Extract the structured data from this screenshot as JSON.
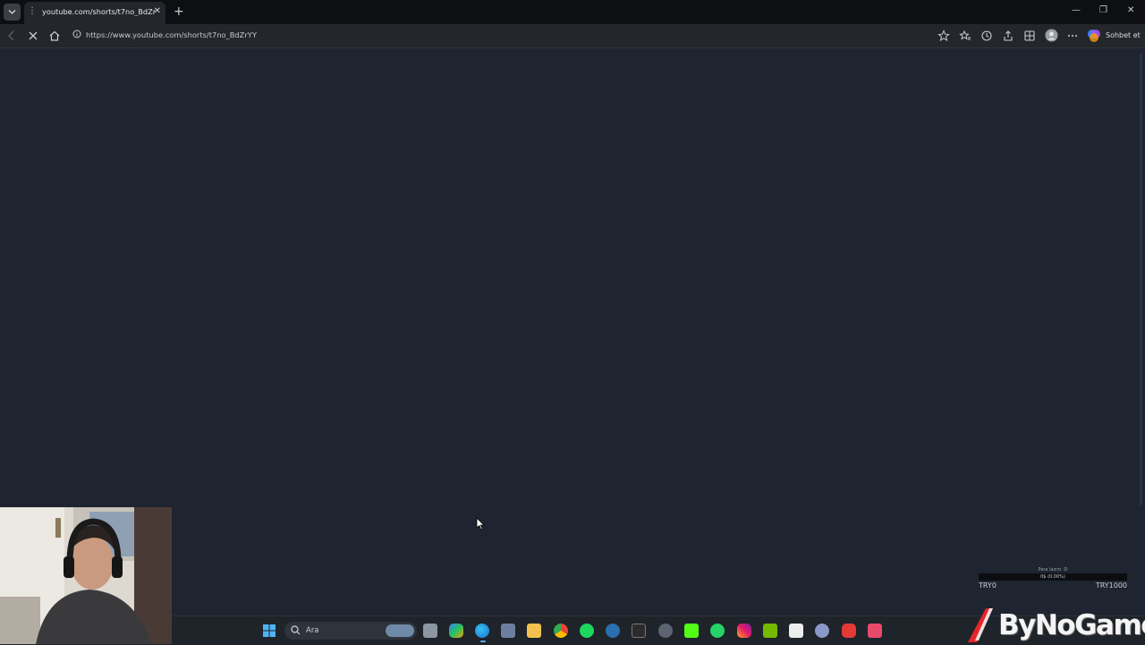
{
  "browser": {
    "tab": {
      "title": "youtube.com/shorts/t7no_BdZrYY",
      "close_glyph": "✕"
    },
    "new_tab_glyph": "+",
    "window_controls": {
      "minimize": "—",
      "restore": "❐",
      "close": "✕"
    },
    "address_bar": {
      "url": "https://www.youtube.com/shorts/t7no_BdZrYY"
    },
    "copilot_label": "Sohbet et",
    "icons": [
      "back-icon",
      "reload-icon",
      "home-icon",
      "favorite-star-icon",
      "favorites-icon",
      "history-icon",
      "share-icon",
      "collections-icon",
      "profile-avatar-icon",
      "more-icon",
      "copilot-icon"
    ]
  },
  "donation_goal": {
    "label": "Para lazım :D",
    "amount": "0$ (0.00%)",
    "min": "TRY0",
    "max": "TRY1000",
    "progress_percent": 0
  },
  "taskbar": {
    "search_placeholder": "Ara",
    "apps": [
      "start",
      "search",
      "task-view",
      "copilot",
      "edge",
      "store",
      "file-explorer",
      "chrome",
      "spotify",
      "steam",
      "epic-games",
      "unknown-app",
      "kick",
      "whatsapp",
      "instagram",
      "nvidia",
      "g-app",
      "discord-like",
      "app-red",
      "app-pink"
    ]
  },
  "logo": {
    "text": "ByNoGame"
  },
  "colors": {
    "page_bg": "#1e2430",
    "titlebar_bg": "#0d0f12",
    "toolbar_bg": "#23262b",
    "taskbar_bg": "#1f232a",
    "logo_red": "#e3262a"
  }
}
